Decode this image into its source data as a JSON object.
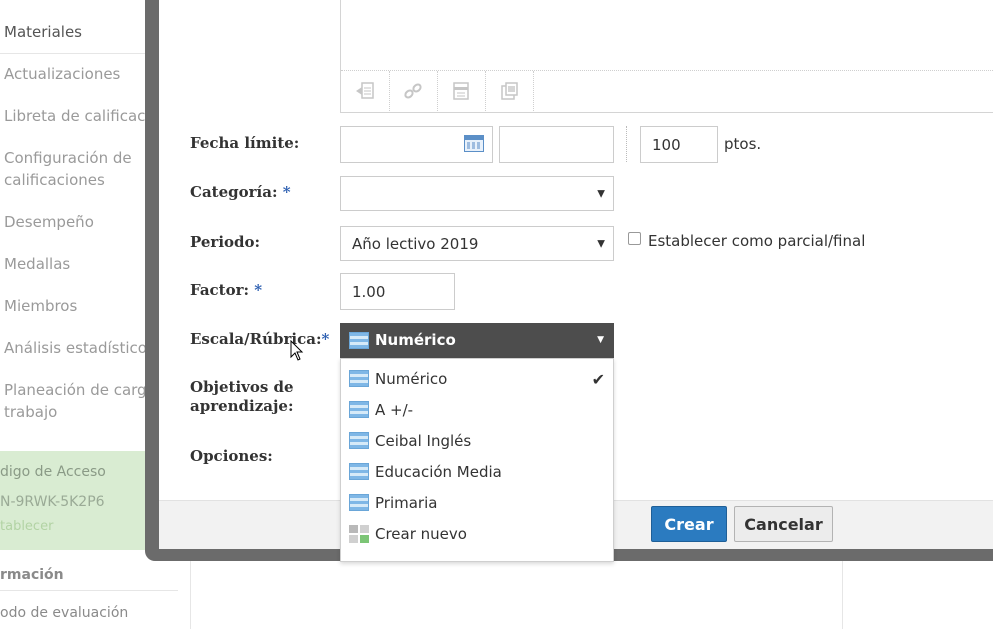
{
  "sidebar": {
    "items": [
      {
        "label": "Materiales"
      },
      {
        "label": "Actualizaciones"
      },
      {
        "label": "Libreta de calificacio"
      },
      {
        "label": "Configuración de"
      },
      {
        "label": "calificaciones"
      },
      {
        "label": "Desempeño"
      },
      {
        "label": "Medallas"
      },
      {
        "label": "Miembros"
      },
      {
        "label": "Análisis estadístico"
      },
      {
        "label": "Planeación de carga"
      },
      {
        "label": "trabajo"
      }
    ],
    "access": {
      "title": "digo de Acceso",
      "code": "N-9RWK-5K2P6",
      "link": "tablecer"
    },
    "info": {
      "title": "rmación",
      "item": "odo de evaluación"
    }
  },
  "form": {
    "due_date": {
      "label": "Fecha límite:",
      "points_value": "100",
      "points_unit": "ptos."
    },
    "category": {
      "label": "Categoría:",
      "required_mark": "*",
      "value": ""
    },
    "period": {
      "label": "Periodo:",
      "value": "Año lectivo 2019",
      "checkbox_label": "Establecer como parcial/final"
    },
    "factor": {
      "label": "Factor:",
      "required_mark": "*",
      "value": "1.00"
    },
    "scale": {
      "label": "Escala/Rúbrica:",
      "required_mark": "*",
      "selected": "Numérico"
    },
    "objectives": {
      "label_line1": "Objetivos de",
      "label_line2": "aprendizaje:"
    },
    "options": {
      "label": "Opciones:"
    }
  },
  "scale_options": [
    {
      "label": "Numérico",
      "selected": true
    },
    {
      "label": "A +/-",
      "selected": false
    },
    {
      "label": "Ceibal Inglés",
      "selected": false
    },
    {
      "label": "Educación Media",
      "selected": false
    },
    {
      "label": "Primaria",
      "selected": false
    },
    {
      "label": "Crear nuevo",
      "selected": false
    }
  ],
  "buttons": {
    "create": "Crear",
    "cancel": "Cancelar"
  },
  "icons": {
    "toolbar": [
      "attach-file-icon",
      "link-icon",
      "document-icon",
      "resource-icon"
    ],
    "calendar": "calendar-icon",
    "check": "✔"
  },
  "colors": {
    "primary": "#2b7bc0",
    "dropdown_header": "#4d4d4d",
    "access_bg": "#d9ecd2",
    "required": "#2a5db0"
  }
}
